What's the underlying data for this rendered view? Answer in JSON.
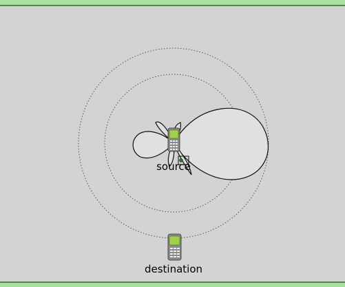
{
  "nodes": {
    "source": {
      "label": "source"
    },
    "destination": {
      "label": "destination"
    }
  },
  "colors": {
    "background": "#d3d3d3",
    "border_green": "#a8e0a0",
    "border_line": "#2f6b2f",
    "range_ring": "#555555",
    "lobe_fill": "#e0e0e0",
    "lobe_stroke": "#111111",
    "phone_screen": "#9fd04a",
    "phone_body": "#8a8a8a"
  },
  "icons": {
    "source": "mobile-phone-icon",
    "destination": "mobile-phone-icon"
  }
}
